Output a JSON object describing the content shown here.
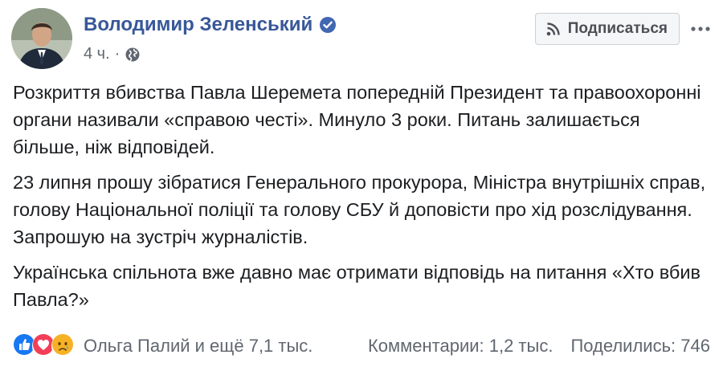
{
  "author": {
    "name": "Володимир Зеленський",
    "time": "4 ч.",
    "separator": "·"
  },
  "actions": {
    "subscribe_label": "Подписаться"
  },
  "post": {
    "paragraphs": [
      "Розкриття вбивства Павла Шеремета попередній Президент та правоохоронні органи називали «справою честі». Минуло 3 роки. Питань залишається більше, ніж відповідей.",
      "23 липня прошу зібратися Генерального прокурора, Міністра внутрішніх справ, голову Національної поліції та голову СБУ й доповісти про хід розслідування. Запрошую на зустріч журналістів.",
      "Українська спільнота вже давно має отримати відповідь на питання «Хто вбив Павла?»"
    ]
  },
  "footer": {
    "reactors": "Ольга Палий и ещё 7,1 тыс.",
    "comments": "Комментарии: 1,2 тыс.",
    "shares": "Поделились: 746"
  },
  "icons": {
    "verified": "verified-badge-icon",
    "privacy": "globe-icon",
    "subscribe": "rss-icon",
    "more": "more-options-icon",
    "reactions": [
      "like-icon",
      "love-icon",
      "sad-icon"
    ]
  },
  "colors": {
    "link": "#385898",
    "meta": "#616770",
    "like": "#1877f2",
    "love": "#f33e58",
    "sad": "#f7b125"
  }
}
